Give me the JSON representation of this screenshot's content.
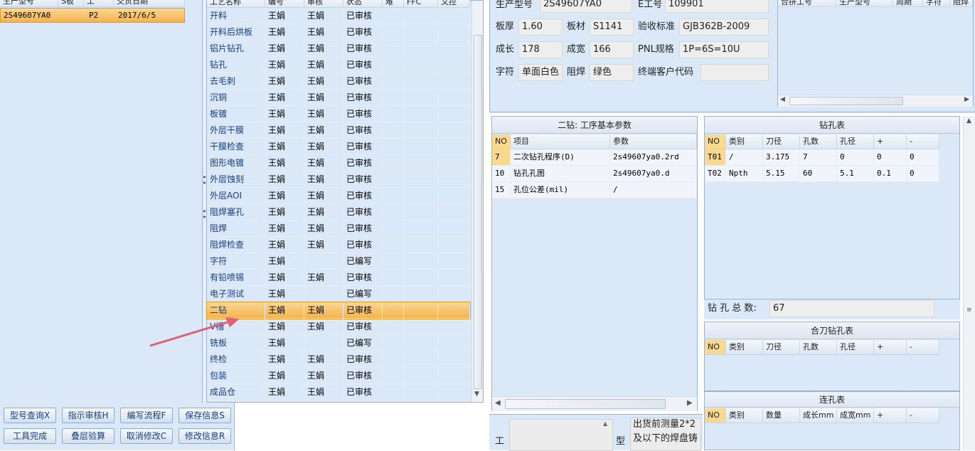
{
  "orders": {
    "headers": [
      "生产型号",
      "S板",
      "工",
      "交货日期"
    ],
    "rows": [
      {
        "model": "2S49607YA0",
        "board": "",
        "code": "P2",
        "date": "2017/6/5"
      }
    ]
  },
  "process": {
    "headers": [
      "工艺名称",
      "编号",
      "审核",
      "状态",
      "难",
      "FFC",
      "文控"
    ],
    "rows": [
      {
        "name": "开料",
        "editor": "王娟",
        "reviewer": "王娟",
        "status": "已审核"
      },
      {
        "name": "开料后烘板",
        "editor": "王娟",
        "reviewer": "王娟",
        "status": "已审核"
      },
      {
        "name": "铝片钻孔",
        "editor": "王娟",
        "reviewer": "王娟",
        "status": "已审核"
      },
      {
        "name": "钻孔",
        "editor": "王娟",
        "reviewer": "王娟",
        "status": "已审核"
      },
      {
        "name": "去毛刺",
        "editor": "王娟",
        "reviewer": "王娟",
        "status": "已审核"
      },
      {
        "name": "沉铜",
        "editor": "王娟",
        "reviewer": "王娟",
        "status": "已审核"
      },
      {
        "name": "板镀",
        "editor": "王娟",
        "reviewer": "王娟",
        "status": "已审核"
      },
      {
        "name": "外层干膜",
        "editor": "王娟",
        "reviewer": "王娟",
        "status": "已审核"
      },
      {
        "name": "干膜检查",
        "editor": "王娟",
        "reviewer": "王娟",
        "status": "已审核"
      },
      {
        "name": "图形电镀",
        "editor": "王娟",
        "reviewer": "王娟",
        "status": "已审核"
      },
      {
        "name": "外层蚀刻",
        "editor": "王娟",
        "reviewer": "王娟",
        "status": "已审核"
      },
      {
        "name": "外层AOI",
        "editor": "王娟",
        "reviewer": "王娟",
        "status": "已审核"
      },
      {
        "name": "阻焊塞孔",
        "editor": "王娟",
        "reviewer": "王娟",
        "status": "已审核"
      },
      {
        "name": "阻焊",
        "editor": "王娟",
        "reviewer": "王娟",
        "status": "已审核"
      },
      {
        "name": "阻焊检查",
        "editor": "王娟",
        "reviewer": "王娟",
        "status": "已审核"
      },
      {
        "name": "字符",
        "editor": "王娟",
        "reviewer": "",
        "status": "已编写"
      },
      {
        "name": "有铅喷锡",
        "editor": "王娟",
        "reviewer": "王娟",
        "status": "已审核"
      },
      {
        "name": "电子测试",
        "editor": "王娟",
        "reviewer": "",
        "status": "已编写"
      },
      {
        "name": "二钻",
        "editor": "王娟",
        "reviewer": "王娟",
        "status": "已审核"
      },
      {
        "name": "V槽",
        "editor": "王娟",
        "reviewer": "王娟",
        "status": "已审核"
      },
      {
        "name": "铣板",
        "editor": "王娟",
        "reviewer": "",
        "status": "已编写"
      },
      {
        "name": "终检",
        "editor": "王娟",
        "reviewer": "王娟",
        "status": "已审核"
      },
      {
        "name": "包装",
        "editor": "王娟",
        "reviewer": "王娟",
        "status": "已审核"
      },
      {
        "name": "成品仓",
        "editor": "王娟",
        "reviewer": "王娟",
        "status": "已审核"
      }
    ],
    "selected_index": 18
  },
  "buttons": [
    {
      "label": "型号查询X",
      "name": "model-query-button"
    },
    {
      "label": "指示审核H",
      "name": "review-button"
    },
    {
      "label": "编写流程F",
      "name": "write-flow-button"
    },
    {
      "label": "保存信息S",
      "name": "save-info-button"
    },
    {
      "label": "工具完成",
      "name": "tool-complete-button"
    },
    {
      "label": "叠层验算",
      "name": "stackup-check-button"
    },
    {
      "label": "取消修改C",
      "name": "cancel-edit-button"
    },
    {
      "label": "修改信息R",
      "name": "edit-info-button"
    }
  ],
  "info": {
    "model_label": "生产型号",
    "model_value": "2S49607YA0",
    "eno_label": "E工号",
    "eno_value": "109901",
    "thickness_label": "板厚",
    "thickness_value": "1.60",
    "material_label": "板材",
    "material_value": "S1141",
    "standard_label": "验收标准",
    "standard_value": "GJB362B-2009",
    "length_label": "成长",
    "length_value": "178",
    "width_label": "成宽",
    "width_value": "166",
    "pnl_label": "PNL规格",
    "pnl_value": "1P=6S=10U",
    "char_label": "字符",
    "char_value": "单面白色",
    "mask_label": "阻焊",
    "mask_value": "绿色",
    "customer_label": "终端客户代码",
    "customer_value": ""
  },
  "combined": {
    "headers": [
      "合拼工号",
      "生产型号",
      "周期",
      "字符",
      "阻焊"
    ]
  },
  "params": {
    "title": "二钻: 工序基本参数",
    "headers": [
      "NO",
      "项目",
      "参数"
    ],
    "rows": [
      {
        "no": "7",
        "item": "二次钻孔程序(D)",
        "value": "2s49607ya0.2rd"
      },
      {
        "no": "10",
        "item": "钻孔孔图",
        "value": "2s49607ya0.d"
      },
      {
        "no": "15",
        "item": "孔位公差(mil)",
        "value": "/"
      }
    ]
  },
  "drill": {
    "title": "钻孔表",
    "headers": [
      "NO",
      "类别",
      "刀径",
      "孔数",
      "孔径",
      "+",
      "-"
    ],
    "rows": [
      {
        "no": "T01",
        "type": "/",
        "tool": "3.175",
        "count": "7",
        "hole": "0",
        "plus": "0",
        "minus": "0"
      },
      {
        "no": "T02",
        "type": "Npth",
        "tool": "5.15",
        "count": "60",
        "hole": "5.1",
        "plus": "0.1",
        "minus": "0"
      }
    ],
    "total_label": "钻 孔 总 数:",
    "total_value": "67"
  },
  "merged": {
    "title": "合刀钻孔表",
    "headers": [
      "NO",
      "类别",
      "刀径",
      "孔数",
      "孔径",
      "+",
      "-"
    ]
  },
  "slot": {
    "title": "连孔表",
    "headers": [
      "NO",
      "类别",
      "数量",
      "成长mm",
      "成宽mm",
      "+",
      "-"
    ]
  },
  "notes": {
    "work_label": "工",
    "type_label": "型",
    "note_line1": "出货前测量2*2",
    "note_line2": "及以下的焊盘铸"
  }
}
